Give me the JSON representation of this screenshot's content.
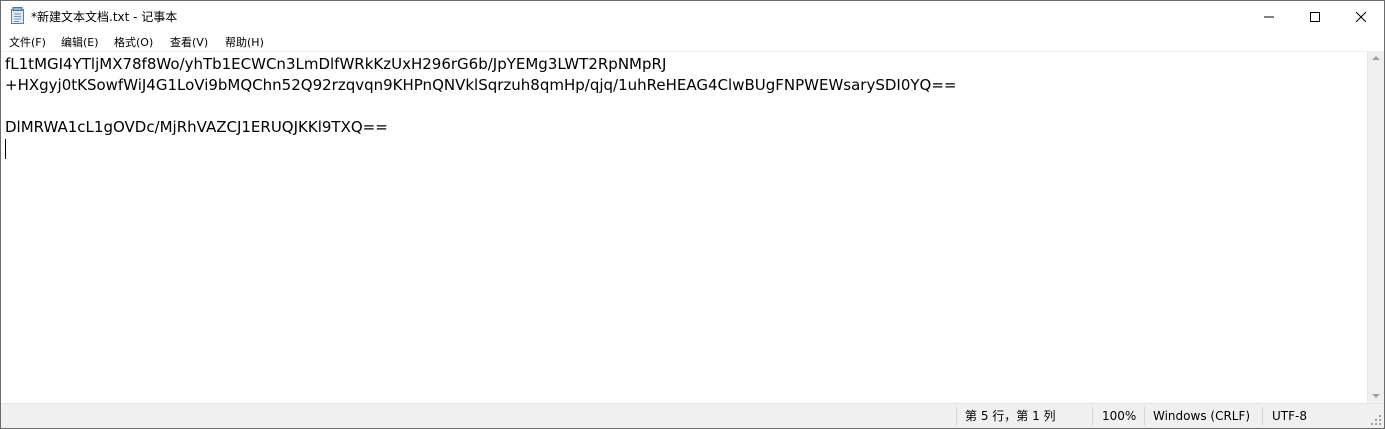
{
  "window": {
    "title": "*新建文本文档.txt - 记事本"
  },
  "menu": {
    "file": "文件(F)",
    "edit": "编辑(E)",
    "format": "格式(O)",
    "view": "查看(V)",
    "help": "帮助(H)"
  },
  "editor": {
    "lines": [
      "fL1tMGI4YTljMX78f8Wo/yhTb1ECWCn3LmDlfWRkKzUxH296rG6b/JpYEMg3LWT2RpNMpRJ",
      "+HXgyj0tKSowfWiJ4G1LoVi9bMQChn52Q92rzqvqn9KHPnQNVklSqrzuh8qmHp/qjq/1uhReHEAG4ClwBUgFNPWEWsarySDI0YQ==",
      "",
      "DlMRWA1cL1gOVDc/MjRhVAZCJ1ERUQJKKl9TXQ==",
      ""
    ]
  },
  "status": {
    "position": "第 5 行，第 1 列",
    "zoom": "100%",
    "line_ending": "Windows (CRLF)",
    "encoding": "UTF-8"
  },
  "icons": {
    "app": "notepad-icon",
    "minimize": "minimize-icon",
    "maximize": "maximize-icon",
    "close": "close-icon"
  }
}
